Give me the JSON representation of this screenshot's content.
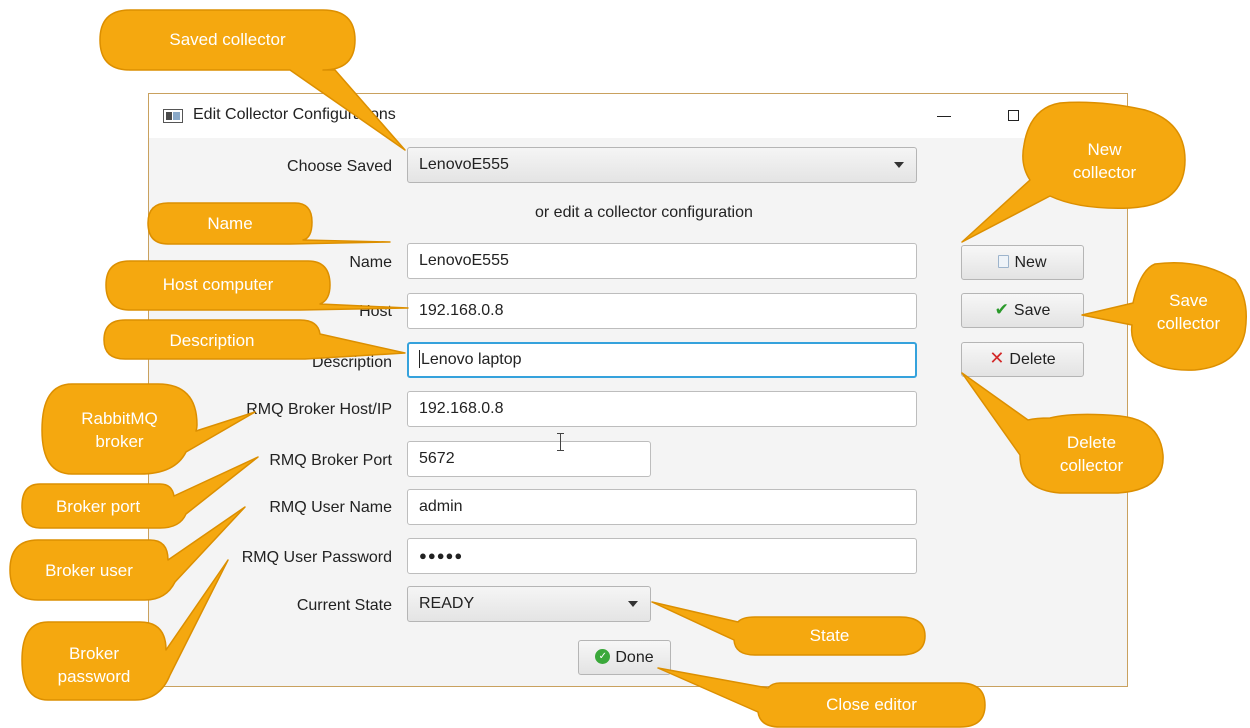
{
  "window": {
    "title": "Edit Collector Configurations"
  },
  "form": {
    "choose_saved_label": "Choose Saved",
    "choose_saved_value": "LenovoE555",
    "or_text": "or edit a collector configuration",
    "name_label": "Name",
    "name_value": "LenovoE555",
    "host_label": "Host",
    "host_value": "192.168.0.8",
    "description_label": "Description",
    "description_value": "Lenovo laptop",
    "broker_host_label": "RMQ Broker Host/IP",
    "broker_host_value": "192.168.0.8",
    "broker_port_label": "RMQ Broker Port",
    "broker_port_value": "5672",
    "user_name_label": "RMQ User Name",
    "user_name_value": "admin",
    "password_label": "RMQ User Password",
    "password_value": "●●●●●",
    "state_label": "Current State",
    "state_value": "READY"
  },
  "buttons": {
    "new_label": "New",
    "save_label": "Save",
    "delete_label": "Delete",
    "done_label": "Done"
  },
  "icons": {
    "new": "document-icon",
    "save": "checkmark-icon",
    "delete": "x-icon",
    "done": "ok-circle-icon"
  },
  "callouts": {
    "saved_collector": "Saved collector",
    "name": "Name",
    "host_computer": "Host computer",
    "description": "Description",
    "rabbitmq_broker_line1": "RabbitMQ",
    "rabbitmq_broker_line2": "broker",
    "broker_port": "Broker port",
    "broker_user": "Broker user",
    "broker_password_line1": "Broker",
    "broker_password_line2": "password",
    "new_collector_line1": "New",
    "new_collector_line2": "collector",
    "save_collector_line1": "Save",
    "save_collector_line2": "collector",
    "delete_collector_line1": "Delete",
    "delete_collector_line2": "collector",
    "state": "State",
    "close_editor": "Close editor"
  },
  "colors": {
    "callout": "#f5a80f",
    "callout_border": "#dc8f00",
    "focus": "#35a2dc"
  }
}
